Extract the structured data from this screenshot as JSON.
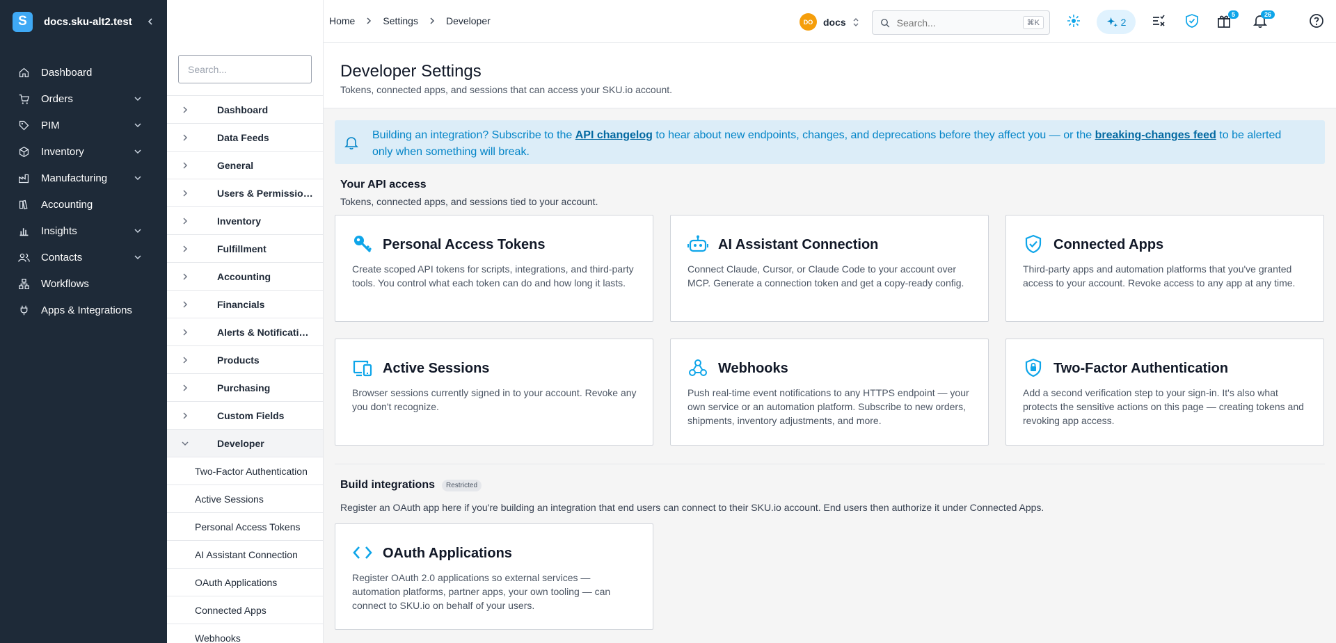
{
  "app": {
    "brand_name": "docs.sku-alt2.test",
    "brand_logo": "S"
  },
  "nav": {
    "items": [
      {
        "label": "Dashboard",
        "icon": "home-icon"
      },
      {
        "label": "Orders",
        "icon": "cart-icon",
        "expandable": true
      },
      {
        "label": "PIM",
        "icon": "tag-icon",
        "expandable": true
      },
      {
        "label": "Inventory",
        "icon": "box-icon",
        "expandable": true
      },
      {
        "label": "Manufacturing",
        "icon": "factory-icon",
        "expandable": true
      },
      {
        "label": "Accounting",
        "icon": "ledger-icon"
      },
      {
        "label": "Insights",
        "icon": "bar-chart-icon",
        "expandable": true
      },
      {
        "label": "Contacts",
        "icon": "users-icon",
        "expandable": true
      },
      {
        "label": "Workflows",
        "icon": "workflow-icon"
      },
      {
        "label": "Apps & Integrations",
        "icon": "plug-icon"
      }
    ]
  },
  "settings_sidebar": {
    "search_placeholder": "Search...",
    "items": [
      "Dashboard",
      "Data Feeds",
      "General",
      "Users & Permissions",
      "Inventory",
      "Fulfillment",
      "Accounting",
      "Financials",
      "Alerts & Notifications",
      "Products",
      "Purchasing",
      "Custom Fields"
    ],
    "active_item": "Developer",
    "sub_items": [
      "Two-Factor Authentication",
      "Active Sessions",
      "Personal Access Tokens",
      "AI Assistant Connection",
      "OAuth Applications",
      "Connected Apps",
      "Webhooks"
    ]
  },
  "topbar": {
    "breadcrumb": [
      "Home",
      "Settings",
      "Developer"
    ],
    "org_initials": "DO",
    "org_name": "docs",
    "search_placeholder": "Search...",
    "search_shortcut": "⌘K",
    "ai_count": "2",
    "gift_badge": "5",
    "notifications_badge": "26"
  },
  "page": {
    "title": "Developer Settings",
    "subtitle": "Tokens, connected apps, and sessions that can access your SKU.io account."
  },
  "banner": {
    "text_1": "Building an integration? Subscribe to the ",
    "link_1": "API changelog",
    "text_2": " to hear about new endpoints, changes, and deprecations before they affect you — or the ",
    "link_2": "breaking-changes feed",
    "text_3": " to be alerted only when something will break."
  },
  "api_access": {
    "title": "Your API access",
    "subtitle": "Tokens, connected apps, and sessions tied to your account.",
    "cards": [
      {
        "title": "Personal Access Tokens",
        "icon": "key-icon",
        "desc": "Create scoped API tokens for scripts, integrations, and third-party tools. You control what each token can do and how long it lasts."
      },
      {
        "title": "AI Assistant Connection",
        "icon": "robot-icon",
        "desc": "Connect Claude, Cursor, or Claude Code to your account over MCP. Generate a connection token and get a copy-ready config."
      },
      {
        "title": "Connected Apps",
        "icon": "shield-check-icon",
        "desc": "Third-party apps and automation platforms that you've granted access to your account. Revoke access to any app at any time."
      },
      {
        "title": "Active Sessions",
        "icon": "devices-icon",
        "desc": "Browser sessions currently signed in to your account. Revoke any you don't recognize."
      },
      {
        "title": "Webhooks",
        "icon": "webhook-icon",
        "desc": "Push real-time event notifications to any HTTPS endpoint — your own service or an automation platform. Subscribe to new orders, shipments, inventory adjustments, and more."
      },
      {
        "title": "Two-Factor Authentication",
        "icon": "shield-lock-icon",
        "desc": "Add a second verification step to your sign-in. It's also what protects the sensitive actions on this page — creating tokens and revoking app access."
      }
    ]
  },
  "build": {
    "title": "Build integrations",
    "badge": "Restricted",
    "subtitle": "Register an OAuth app here if you're building an integration that end users can connect to their SKU.io account. End users then authorize it under Connected Apps.",
    "card": {
      "title": "OAuth Applications",
      "icon": "code-icon",
      "desc": "Register OAuth 2.0 applications so external services — automation platforms, partner apps, your own tooling — can connect to SKU.io on behalf of your users."
    }
  },
  "colors": {
    "nav_bg": "#1e2a38",
    "accent": "#0ea5e9",
    "banner_bg": "#dcedf8"
  }
}
